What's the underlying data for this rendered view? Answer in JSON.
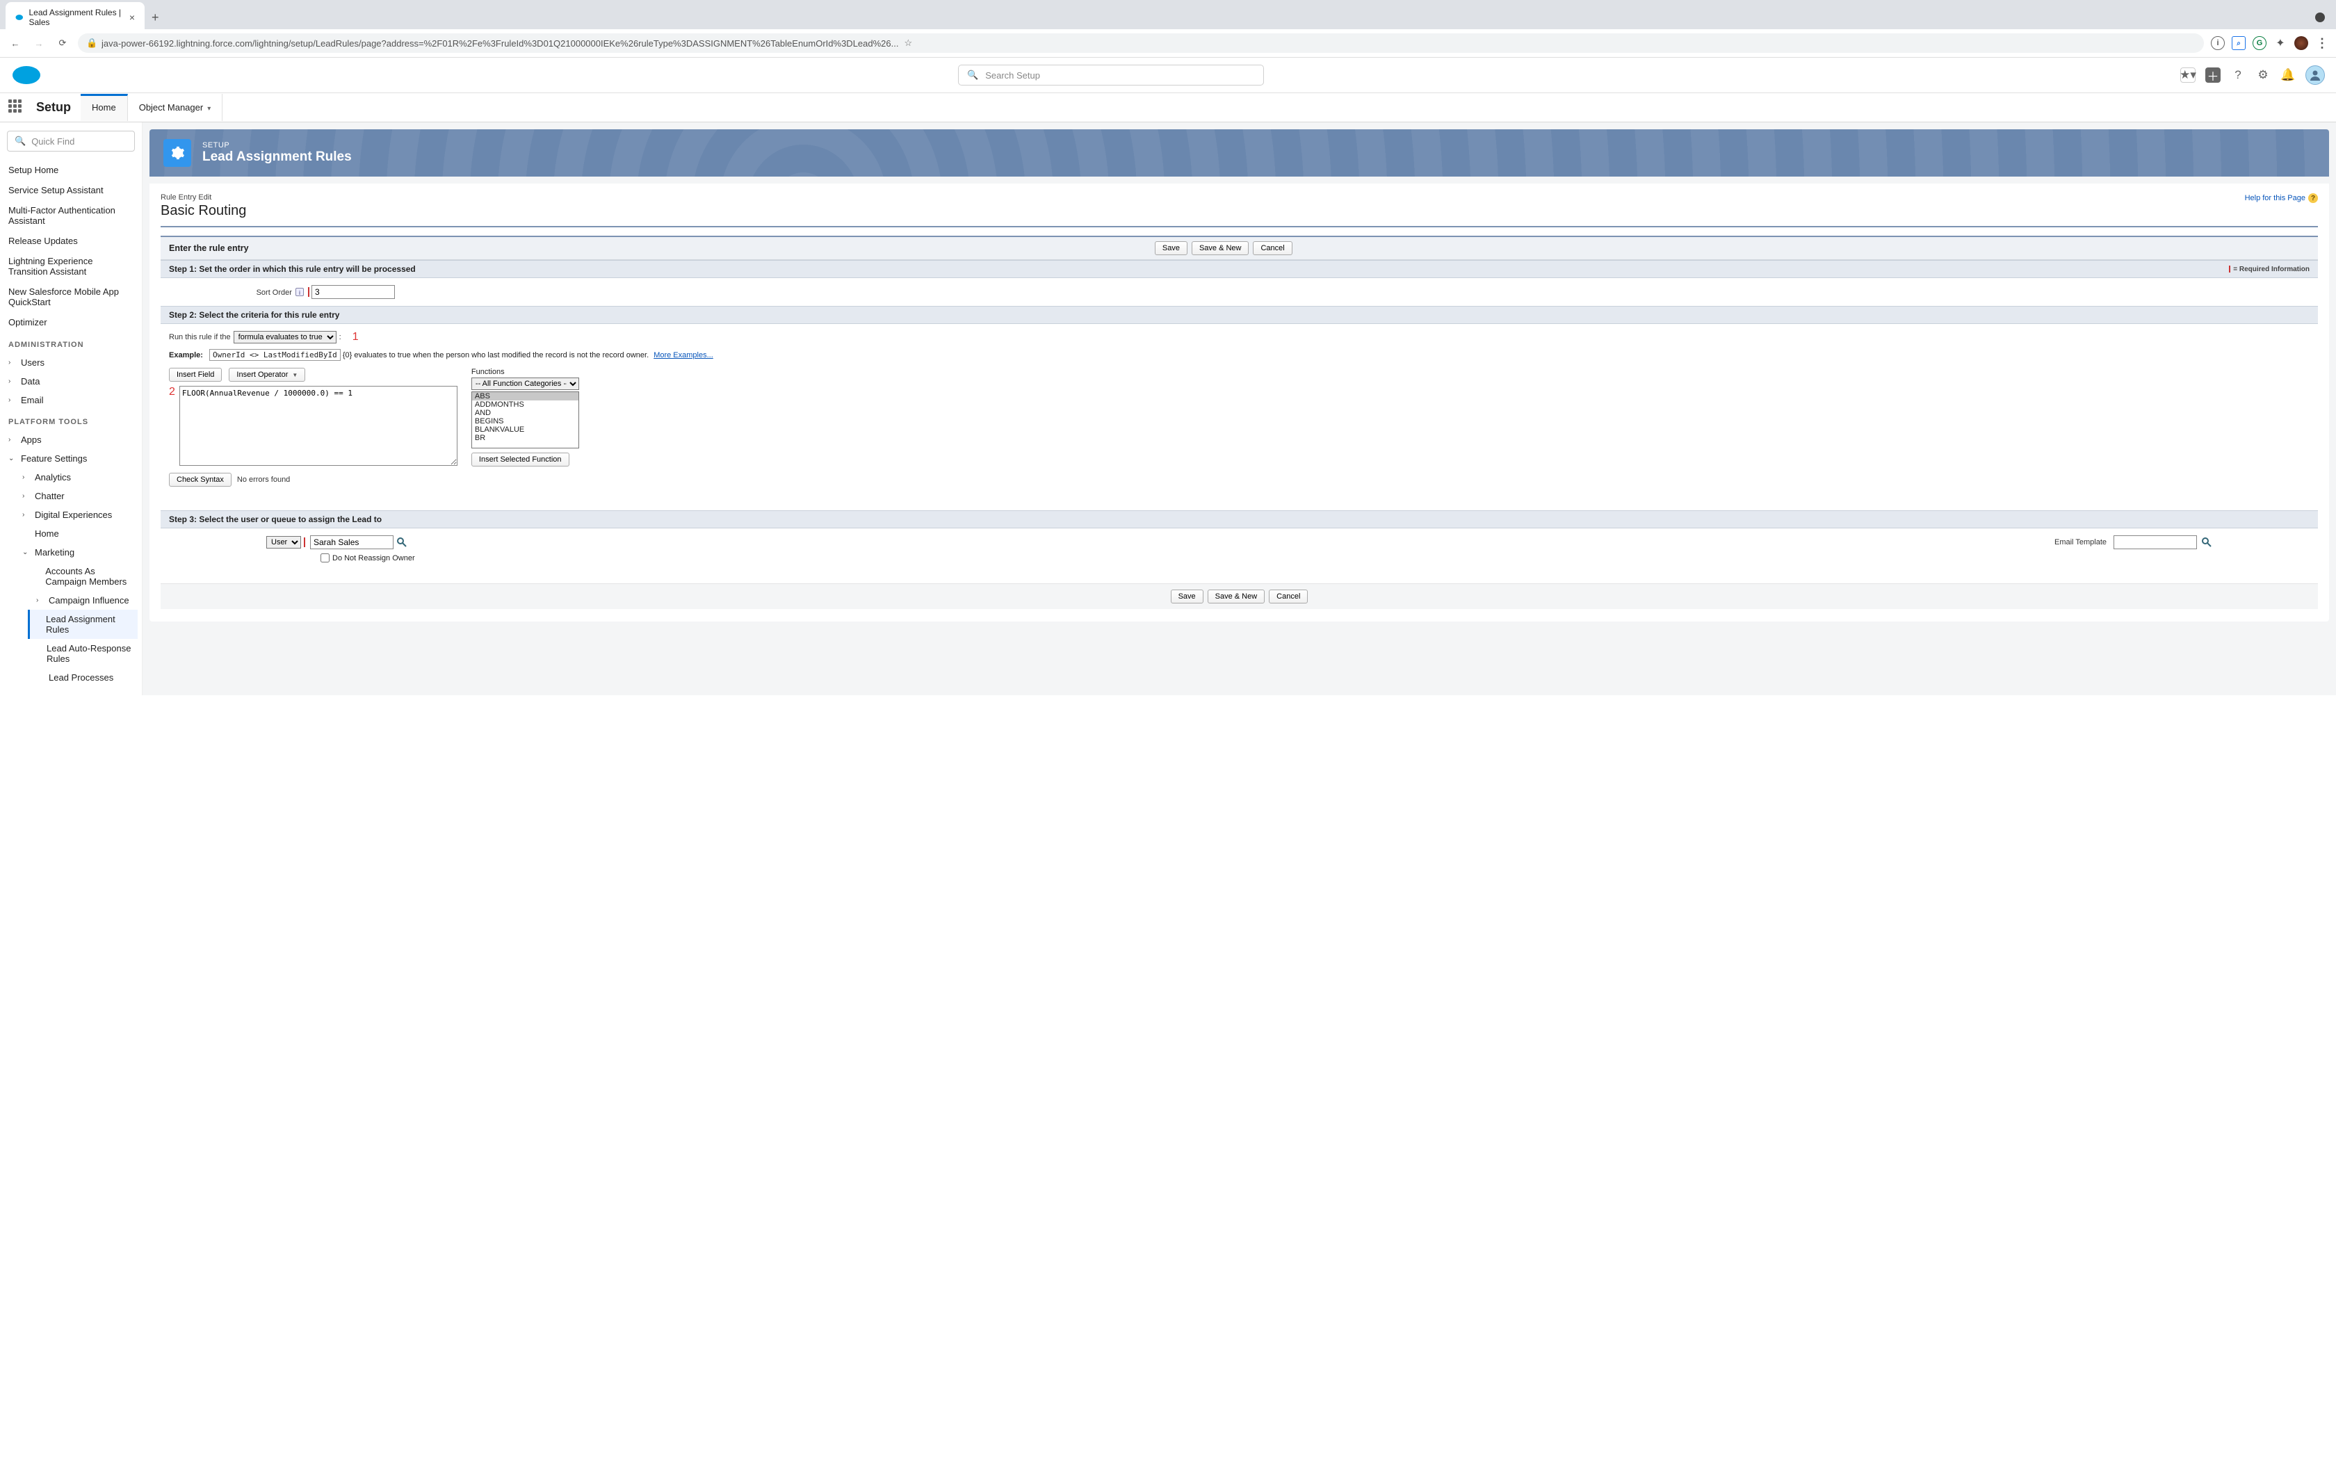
{
  "browser": {
    "tab_title": "Lead Assignment Rules | Sales",
    "url": "java-power-66192.lightning.force.com/lightning/setup/LeadRules/page?address=%2F01R%2Fe%3FruleId%3D01Q21000000IEKe%26ruleType%3DASSIGNMENT%26TableEnumOrId%3DLead%26..."
  },
  "topbar": {
    "search_placeholder": "Search Setup"
  },
  "setup_row": {
    "title": "Setup",
    "tabs": {
      "home": "Home",
      "object_manager": "Object Manager"
    }
  },
  "sidebar": {
    "quickfind_placeholder": "Quick Find",
    "items": [
      "Setup Home",
      "Service Setup Assistant",
      "Multi-Factor Authentication Assistant",
      "Release Updates",
      "Lightning Experience Transition Assistant",
      "New Salesforce Mobile App QuickStart",
      "Optimizer"
    ],
    "admin_label": "ADMINISTRATION",
    "admin_tree": [
      "Users",
      "Data",
      "Email"
    ],
    "platform_label": "PLATFORM TOOLS",
    "apps": "Apps",
    "feature_settings": "Feature Settings",
    "fs_children": [
      "Analytics",
      "Chatter",
      "Digital Experiences",
      "Home",
      "Marketing"
    ],
    "marketing_children": [
      "Accounts As Campaign Members",
      "Campaign Influence",
      "Lead Assignment Rules",
      "Lead Auto-Response Rules",
      "Lead Processes"
    ]
  },
  "header": {
    "eyebrow": "SETUP",
    "title": "Lead Assignment Rules"
  },
  "panel": {
    "rule_eye": "Rule Entry Edit",
    "rule_title": "Basic Routing",
    "help": "Help for this Page",
    "enter_bar": "Enter the rule entry",
    "buttons": {
      "save": "Save",
      "save_new": "Save & New",
      "cancel": "Cancel"
    },
    "required_note": "= Required Information",
    "step1": {
      "title": "Step 1: Set the order in which this rule entry will be processed",
      "sort_label": "Sort Order",
      "sort_value": "3"
    },
    "step2": {
      "title": "Step 2: Select the criteria for this rule entry",
      "run_label": "Run this rule if the",
      "run_select": "formula evaluates to true",
      "annot1": "1",
      "example_label": "Example:",
      "example_code": "OwnerId <> LastModifiedById",
      "example_rest": "{0} evaluates to true when the person who last modified the record is not the record owner.",
      "more": "More Examples...",
      "insert_field": "Insert Field",
      "insert_operator": "Insert Operator",
      "annot2": "2",
      "formula": "FLOOR(AnnualRevenue / 1000000.0) == 1",
      "functions_label": "Functions",
      "func_category": "-- All Function Categories --",
      "func_list": [
        "ABS",
        "ADDMONTHS",
        "AND",
        "BEGINS",
        "BLANKVALUE",
        "BR"
      ],
      "insert_selected_fn": "Insert Selected Function",
      "check_syntax": "Check Syntax",
      "no_errors": "No errors found"
    },
    "step3": {
      "title": "Step 3: Select the user or queue to assign the Lead to",
      "assignee_type": "User",
      "assignee_name": "Sarah Sales",
      "email_template_label": "Email Template",
      "email_template_value": "",
      "checkbox_label": "Do Not Reassign Owner"
    }
  }
}
